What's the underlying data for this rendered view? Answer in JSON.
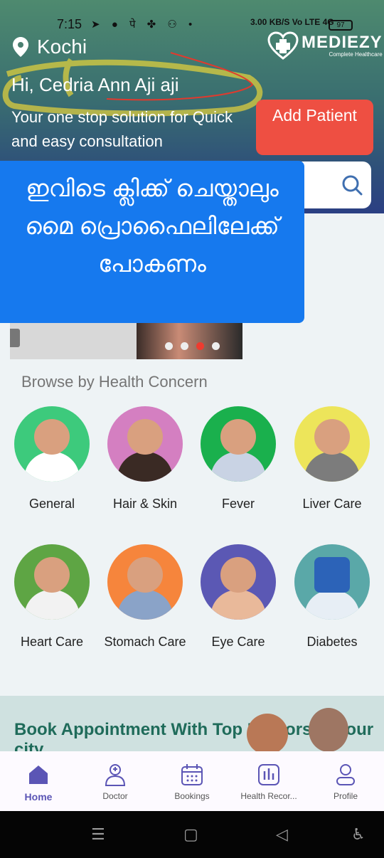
{
  "status_bar": {
    "time": "7:15",
    "net_speed": "3.00 KB/S",
    "network": "Vo LTE 4G",
    "battery": "97",
    "left_icons": "➤ ● पे ✤ ⚇ •"
  },
  "header": {
    "location": "Kochi",
    "logo_name": "MEDIEZY",
    "logo_tagline": "Complete Healthcare",
    "greeting": "Hi, Cedria Ann Aji aji",
    "tagline": "Your one stop solution for Quick and easy consultation",
    "add_patient_label": "Add Patient"
  },
  "overlay_text": "ഇവിടെ ക്ലിക്ക് ചെയ്താലും മൈ പ്രൊഫൈലിലേക്ക് പോകണം",
  "browse": {
    "title": "Browse by Health Concern",
    "items": [
      {
        "label": "General",
        "color": "#3dca7c"
      },
      {
        "label": "Hair & Skin",
        "color": "#d47fc1"
      },
      {
        "label": "Fever",
        "color": "#1ab04d"
      },
      {
        "label": "Liver Care",
        "color": "#ede55a"
      },
      {
        "label": "Heart Care",
        "color": "#5ea544"
      },
      {
        "label": "Stomach Care",
        "color": "#f6853c"
      },
      {
        "label": "Eye Care",
        "color": "#5b58b4"
      },
      {
        "label": "Diabetes",
        "color": "#5aa8a8"
      }
    ]
  },
  "promo": {
    "title": "Book Appointment With Top Doctors in your city"
  },
  "nav": {
    "items": [
      {
        "label": "Home",
        "icon": "home-icon"
      },
      {
        "label": "Doctor",
        "icon": "doctor-icon"
      },
      {
        "label": "Bookings",
        "icon": "calendar-icon"
      },
      {
        "label": "Health Recor...",
        "icon": "chart-icon"
      },
      {
        "label": "Profile",
        "icon": "profile-icon"
      }
    ]
  },
  "colors": {
    "accent": "#5b55b5",
    "add_button": "#ee4f42",
    "overlay": "#1679ee"
  }
}
